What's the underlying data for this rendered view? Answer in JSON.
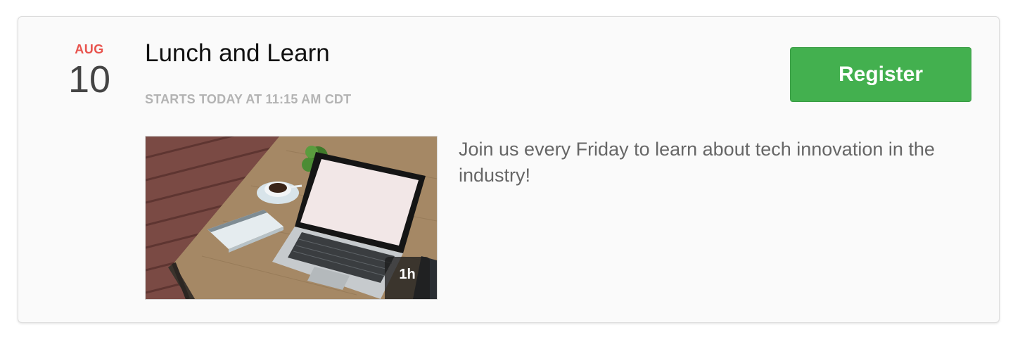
{
  "event": {
    "month": "AUG",
    "day": "10",
    "title": "Lunch and Learn",
    "starts": "STARTS TODAY AT 11:15 AM CDT",
    "register_label": "Register",
    "duration": "1h",
    "description": "Join us every Friday to learn about tech innovation in the industry!"
  },
  "colors": {
    "month": "#e8534d",
    "register_bg": "#43b04f"
  }
}
